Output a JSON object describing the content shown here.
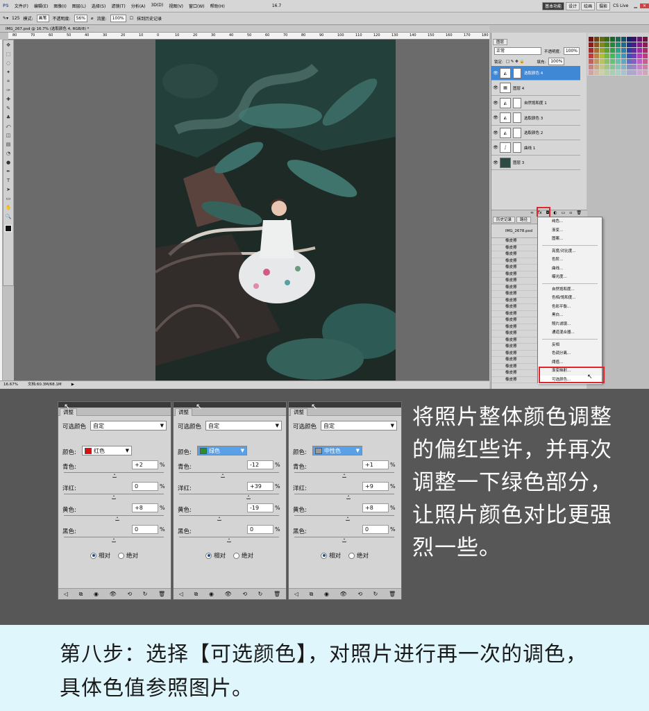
{
  "menubar": {
    "logo": "PS",
    "items": [
      "文件(F)",
      "编辑(E)",
      "图像(I)",
      "图层(L)",
      "选择(S)",
      "滤镜(T)",
      "分析(A)",
      "3D(D)",
      "视图(V)",
      "窗口(W)",
      "帮助(H)"
    ],
    "zoom": "16.7",
    "workspaces": [
      "基本功能",
      "设计",
      "绘画",
      "摄影"
    ],
    "cslive": "CS Live"
  },
  "options": {
    "brush_size": "125",
    "mode_label": "模式:",
    "mode_value": "画笔",
    "opacity_label": "不透明度:",
    "opacity_value": "56%",
    "flow_label": "流量:",
    "flow_value": "100%",
    "erase_history": "抹到历史记录"
  },
  "document": {
    "tab": "IMG_267.psd @ 16.7% (选取颜色 4, RGB/8) *",
    "ruler": [
      "80",
      "70",
      "60",
      "50",
      "40",
      "30",
      "20",
      "10",
      "0",
      "10",
      "20",
      "30",
      "40",
      "50",
      "60",
      "70",
      "80",
      "90",
      "100",
      "110",
      "120",
      "130",
      "140",
      "150",
      "160",
      "170",
      "180"
    ],
    "zoom": "16.67%",
    "doc_size": "文档:60.3M/68.1M"
  },
  "tools": [
    "move",
    "marquee",
    "lasso",
    "quick-select",
    "crop",
    "eyedropper",
    "heal",
    "brush",
    "stamp",
    "history-brush",
    "eraser",
    "gradient",
    "blur",
    "dodge",
    "pen",
    "type",
    "path-select",
    "shape",
    "hand",
    "zoom"
  ],
  "layers": {
    "tab": "图层",
    "mode": "正常",
    "opacity_label": "不透明度:",
    "opacity": "100%",
    "lock_label": "锁定:",
    "fill_label": "填充:",
    "fill": "100%",
    "items": [
      {
        "name": "选取颜色 4",
        "selected": true,
        "icon": "adjustment"
      },
      {
        "name": "图层 4",
        "selected": false,
        "icon": "layer"
      },
      {
        "name": "自然饱和度 1",
        "selected": false,
        "icon": "adjustment"
      },
      {
        "name": "选取颜色 3",
        "selected": false,
        "icon": "adjustment"
      },
      {
        "name": "选取颜色 2",
        "selected": false,
        "icon": "adjustment"
      },
      {
        "name": "曲线 1",
        "selected": false,
        "icon": "curves"
      },
      {
        "name": "图层 3",
        "selected": false,
        "icon": "photo"
      }
    ]
  },
  "history": {
    "tabs": [
      "历史记录",
      "路径"
    ],
    "snapshot": "IMG_2678.psd",
    "items": [
      "橡皮擦",
      "橡皮擦",
      "橡皮擦",
      "橡皮擦",
      "橡皮擦",
      "橡皮擦",
      "橡皮擦",
      "橡皮擦",
      "橡皮擦",
      "橡皮擦",
      "橡皮擦",
      "橡皮擦",
      "橡皮擦",
      "橡皮擦",
      "橡皮擦",
      "橡皮擦",
      "橡皮擦",
      "橡皮擦",
      "橡皮擦",
      "橡皮擦",
      "橡皮擦",
      "橡皮擦"
    ]
  },
  "fill_menu": {
    "items": [
      "纯色...",
      "渐变...",
      "图案...",
      "-",
      "亮度/对比度...",
      "色阶...",
      "曲线...",
      "曝光度...",
      "-",
      "自然饱和度...",
      "色相/饱和度...",
      "色彩平衡...",
      "黑白...",
      "照片滤镜...",
      "通道混合器...",
      "-",
      "反相",
      "色调分离...",
      "阈值...",
      "渐变映射...",
      "可选颜色..."
    ],
    "highlighted": "可选颜色..."
  },
  "adjust_panels": [
    {
      "tab": "调整",
      "title": "可选颜色",
      "preset": "自定",
      "color_label": "颜色:",
      "color_name": "红色",
      "color_hex": "#d01414",
      "rows": [
        {
          "label": "青色:",
          "value": "+2"
        },
        {
          "label": "洋红:",
          "value": "0"
        },
        {
          "label": "黄色:",
          "value": "+8"
        },
        {
          "label": "黑色:",
          "value": "0"
        }
      ],
      "relative": "相对",
      "absolute": "绝对"
    },
    {
      "tab": "调整",
      "title": "可选颜色",
      "preset": "自定",
      "color_label": "颜色:",
      "color_name": "绿色",
      "color_hex": "#2e8b2e",
      "rows": [
        {
          "label": "青色:",
          "value": "-12"
        },
        {
          "label": "洋红:",
          "value": "+39"
        },
        {
          "label": "黄色:",
          "value": "-19"
        },
        {
          "label": "黑色:",
          "value": "0"
        }
      ],
      "relative": "相对",
      "absolute": "绝对"
    },
    {
      "tab": "调整",
      "title": "可选颜色",
      "preset": "自定",
      "color_label": "颜色:",
      "color_name": "中性色",
      "color_hex": "#9a9a9a",
      "rows": [
        {
          "label": "青色:",
          "value": "+1"
        },
        {
          "label": "洋红:",
          "value": "+9"
        },
        {
          "label": "黄色:",
          "value": "+8"
        },
        {
          "label": "黑色:",
          "value": "0"
        }
      ],
      "relative": "相对",
      "absolute": "绝对"
    }
  ],
  "side_text": "将照片整体颜色调整的偏红些许，并再次调整一下绿色部分，让照片颜色对比更强烈一些。",
  "step_text": "第八步：选择【可选颜色】，对照片进行再一次的调色，具体色值参照图片。",
  "colors": {
    "accent": "#3e88d6",
    "highlight": "#e3222a",
    "step_bg": "#dff6fc",
    "backdrop": "#575757"
  }
}
